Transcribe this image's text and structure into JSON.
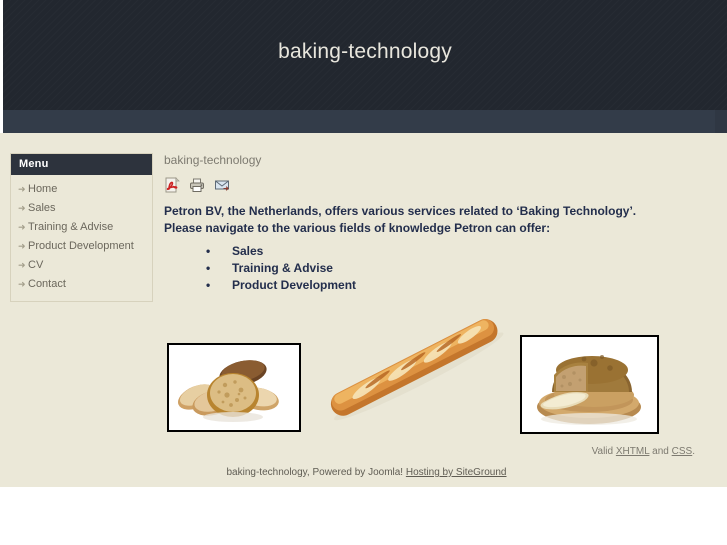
{
  "header": {
    "site_title": "baking-technology",
    "bg_color": "#22272f",
    "title_color": "#e8e6dd"
  },
  "sidebar": {
    "module_title": "Menu",
    "arrow_glyph": "➜",
    "items": [
      {
        "label": "Home",
        "name": "sidebar-item-home"
      },
      {
        "label": "Sales",
        "name": "sidebar-item-sales"
      },
      {
        "label": "Training & Advise",
        "name": "sidebar-item-training-advise"
      },
      {
        "label": "Product Development",
        "name": "sidebar-item-product-development"
      },
      {
        "label": "CV",
        "name": "sidebar-item-cv"
      },
      {
        "label": "Contact",
        "name": "sidebar-item-contact"
      }
    ]
  },
  "content": {
    "title": "baking-technology",
    "icons": [
      {
        "name": "pdf-icon",
        "label": "PDF"
      },
      {
        "name": "print-icon",
        "label": "Print"
      },
      {
        "name": "email-icon",
        "label": "E-mail"
      }
    ],
    "intro_line_1": "Petron BV, the Netherlands, offers various services related to ‘Baking Technology’.",
    "intro_line_2": "Please navigate to the various fields of knowledge Petron can offer:",
    "bullet_glyph": "•",
    "services": [
      "Sales",
      "Training & Advise",
      "Product Development"
    ],
    "text_color": "#232e4c",
    "images": [
      {
        "name": "photo-bread-slices",
        "alt": "Sliced bread"
      },
      {
        "name": "photo-baguette",
        "alt": "Baguette"
      },
      {
        "name": "photo-round-loaf",
        "alt": "Round rustic loaf on wooden board"
      }
    ]
  },
  "footer": {
    "valid_prefix": "Valid ",
    "valid_xhtml": "XHTML",
    "valid_middle": " and ",
    "valid_css": "CSS",
    "valid_suffix": ".",
    "credit_text": "baking-technology, Powered by Joomla! ",
    "credit_link": "Hosting by SiteGround",
    "background": "#ebe8d8"
  }
}
